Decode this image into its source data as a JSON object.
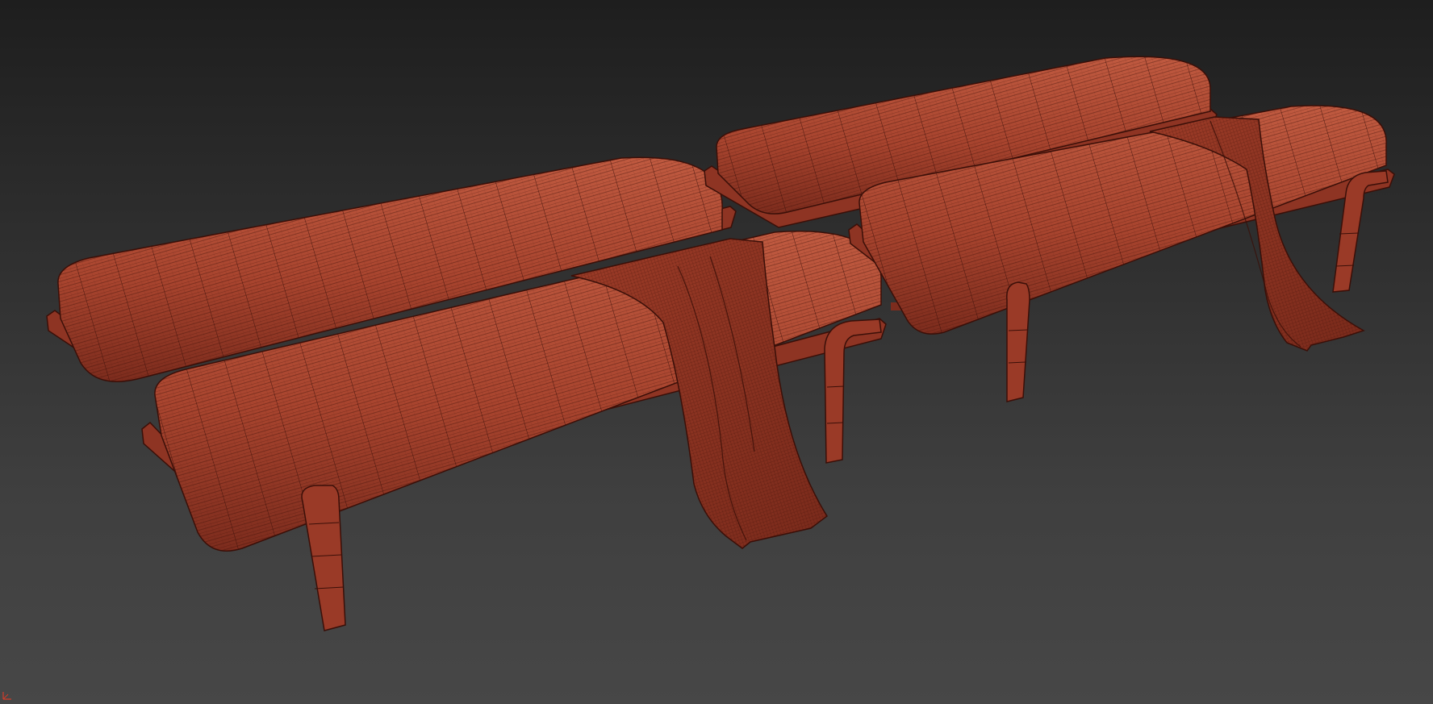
{
  "viewport": {
    "view_type": "perspective",
    "render_mode": "wireframe-on-shaded",
    "background_colors": [
      "#1e1e1e",
      "#474747"
    ]
  },
  "scene": {
    "objects": [
      {
        "name": "bench-back-left",
        "type": "bench",
        "has_throw": false
      },
      {
        "name": "bench-front-left",
        "type": "bench",
        "has_throw": true
      },
      {
        "name": "bench-back-right",
        "type": "bench",
        "has_throw": false
      },
      {
        "name": "bench-front-right",
        "type": "bench",
        "has_throw": true
      }
    ],
    "colors": {
      "mesh_fill": "#a8442e",
      "mesh_fill_dark": "#7d2c1d",
      "mesh_fill_light": "#c05a40",
      "wire": "#3a0f08"
    }
  },
  "axis_gizmo": {
    "icon": "axis-tripod-icon",
    "color": "#d33c2a"
  }
}
